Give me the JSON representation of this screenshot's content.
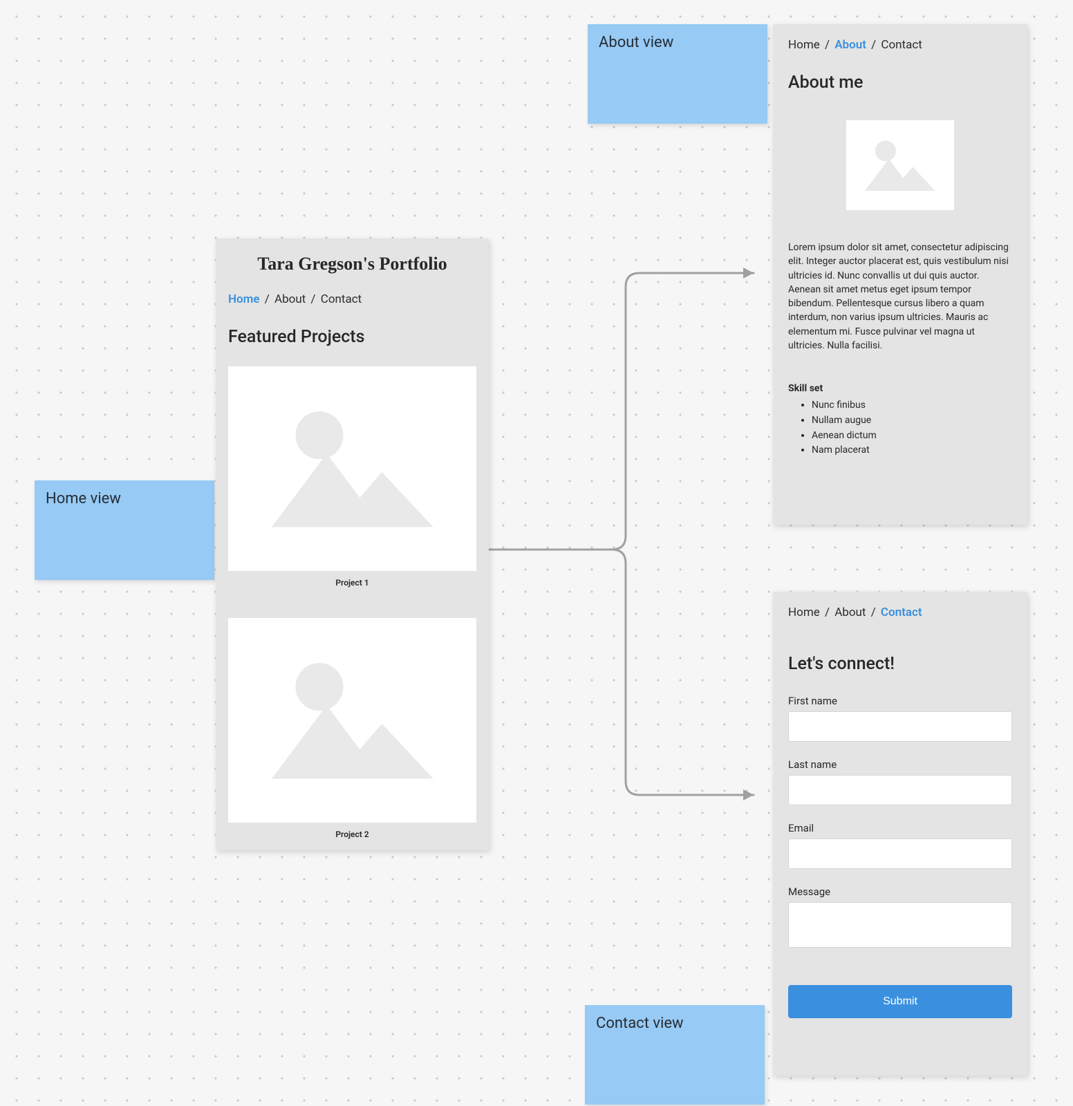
{
  "labels": {
    "home": "Home view",
    "about": "About view",
    "contact": "Contact view"
  },
  "nav": {
    "home": "Home",
    "about": "About",
    "contact": "Contact",
    "sep": "/"
  },
  "home": {
    "site_title": "Tara Gregson's Portfolio",
    "heading": "Featured Projects",
    "projects": [
      "Project 1",
      "Project 2"
    ]
  },
  "about": {
    "heading": "About me",
    "body": "Lorem ipsum dolor sit amet, consectetur adipiscing elit. Integer auctor placerat est, quis vestibulum nisi ultricies id. Nunc convallis ut dui quis auctor. Aenean sit amet metus eget ipsum tempor bibendum. Pellentesque cursus libero a quam interdum, non varius ipsum ultricies. Mauris ac elementum mi. Fusce pulvinar vel magna ut ultricies. Nulla facilisi.",
    "skill_label": "Skill set",
    "skills": [
      "Nunc finibus",
      "Nullam augue",
      "Aenean dictum",
      "Nam placerat"
    ]
  },
  "contact": {
    "heading": "Let's connect!",
    "first_name": "First name",
    "last_name": "Last name",
    "email": "Email",
    "message": "Message",
    "submit": "Submit"
  }
}
